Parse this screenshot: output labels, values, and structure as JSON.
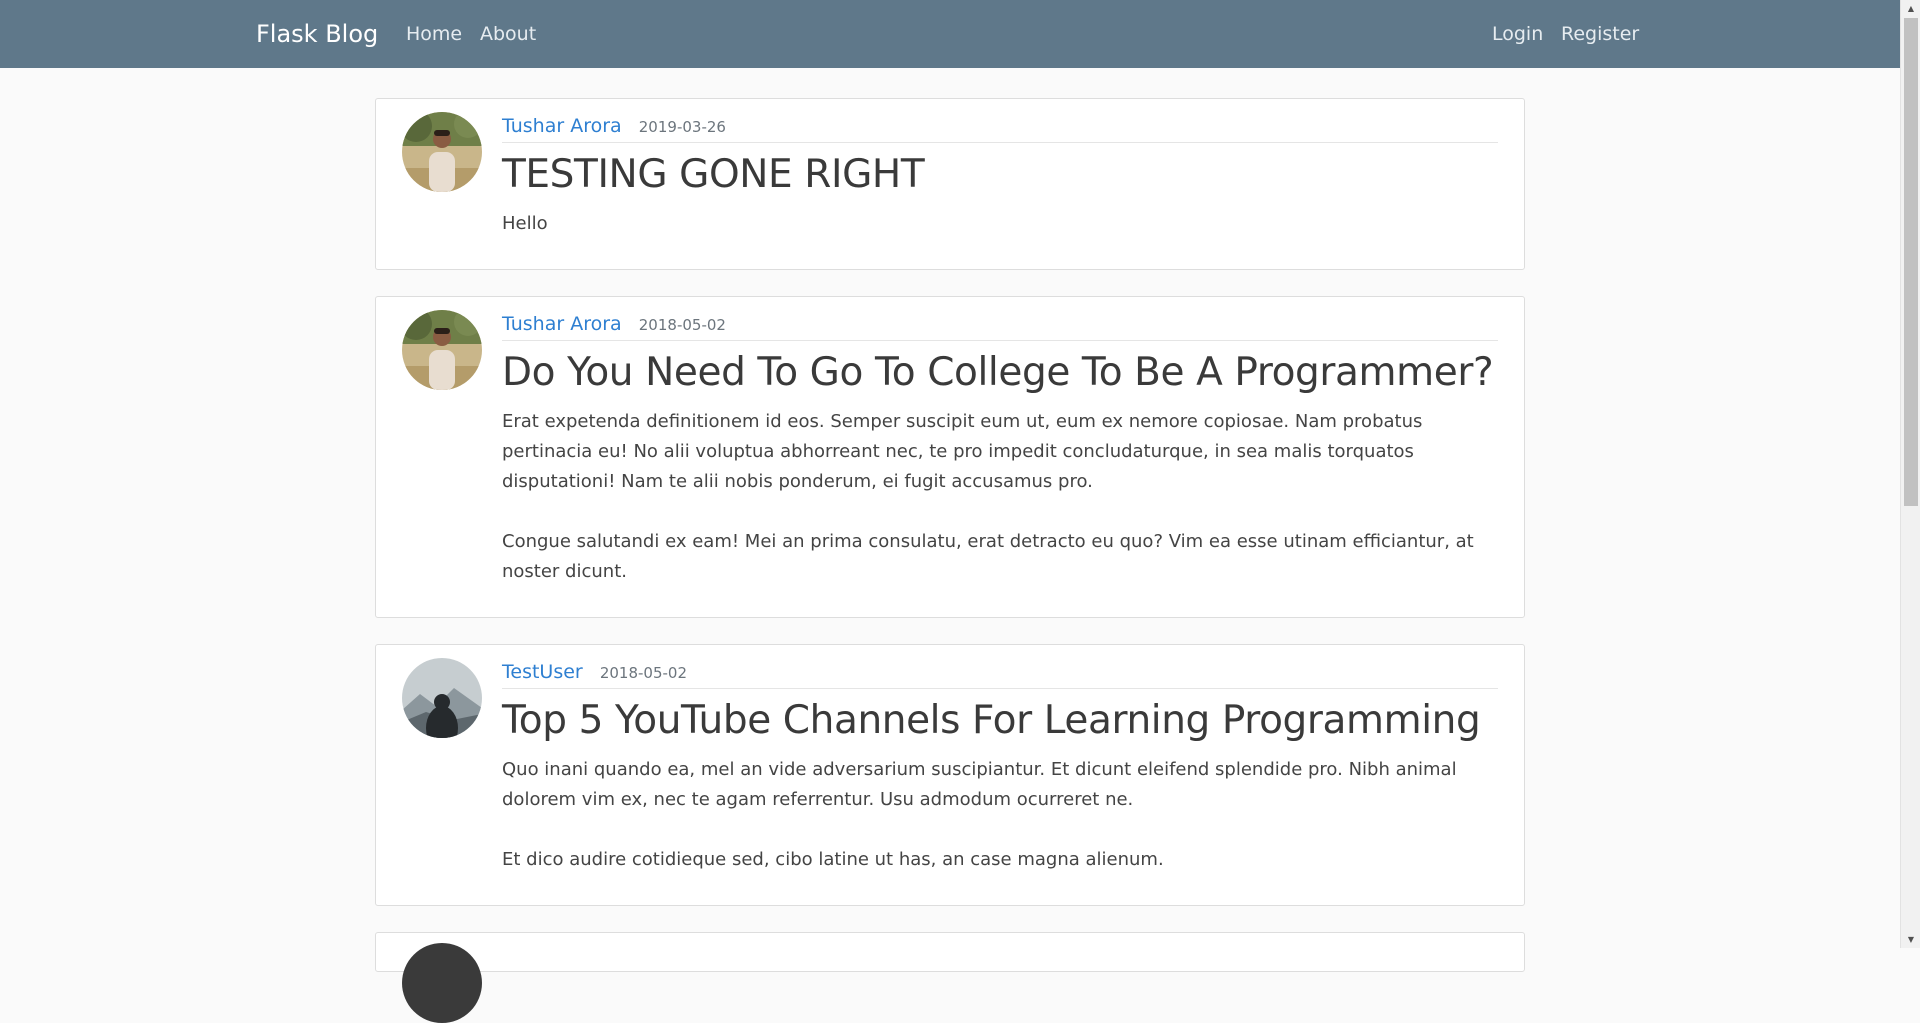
{
  "navbar": {
    "brand": "Flask Blog",
    "links": [
      "Home",
      "About"
    ],
    "auth_links": [
      "Login",
      "Register"
    ],
    "background": "#5f788a"
  },
  "posts": [
    {
      "author": "Tushar Arora",
      "date": "2019-03-26",
      "title": "TESTING GONE RIGHT",
      "content": "Hello",
      "avatar": "man-outdoor-photo"
    },
    {
      "author": "Tushar Arora",
      "date": "2018-05-02",
      "title": "Do You Need To Go To College To Be A Programmer?",
      "content": "Erat expetenda definitionem id eos. Semper suscipit eum ut, eum ex nemore copiosae. Nam probatus pertinacia eu! No alii voluptua abhorreant nec, te pro impedit concludaturque, in sea malis torquatos disputationi! Nam te alii nobis ponderum, ei fugit accusamus pro.\n\nCongue salutandi ex eam! Mei an prima consulatu, erat detracto eu quo? Vim ea esse utinam efficiantur, at noster dicunt.",
      "avatar": "man-outdoor-photo"
    },
    {
      "author": "TestUser",
      "date": "2018-05-02",
      "title": "Top 5 YouTube Channels For Learning Programming",
      "content": "Quo inani quando ea, mel an vide adversarium suscipiantur. Et dicunt eleifend splendide pro. Nibh animal dolorem vim ex, nec te agam referrentur. Usu admodum ocurreret ne.\n\nEt dico audire cotidieque sed, cibo latine ut has, an case magna alienum.",
      "avatar": "silhouette-mountains-photo"
    }
  ],
  "accent_color": "#2e7fd1"
}
